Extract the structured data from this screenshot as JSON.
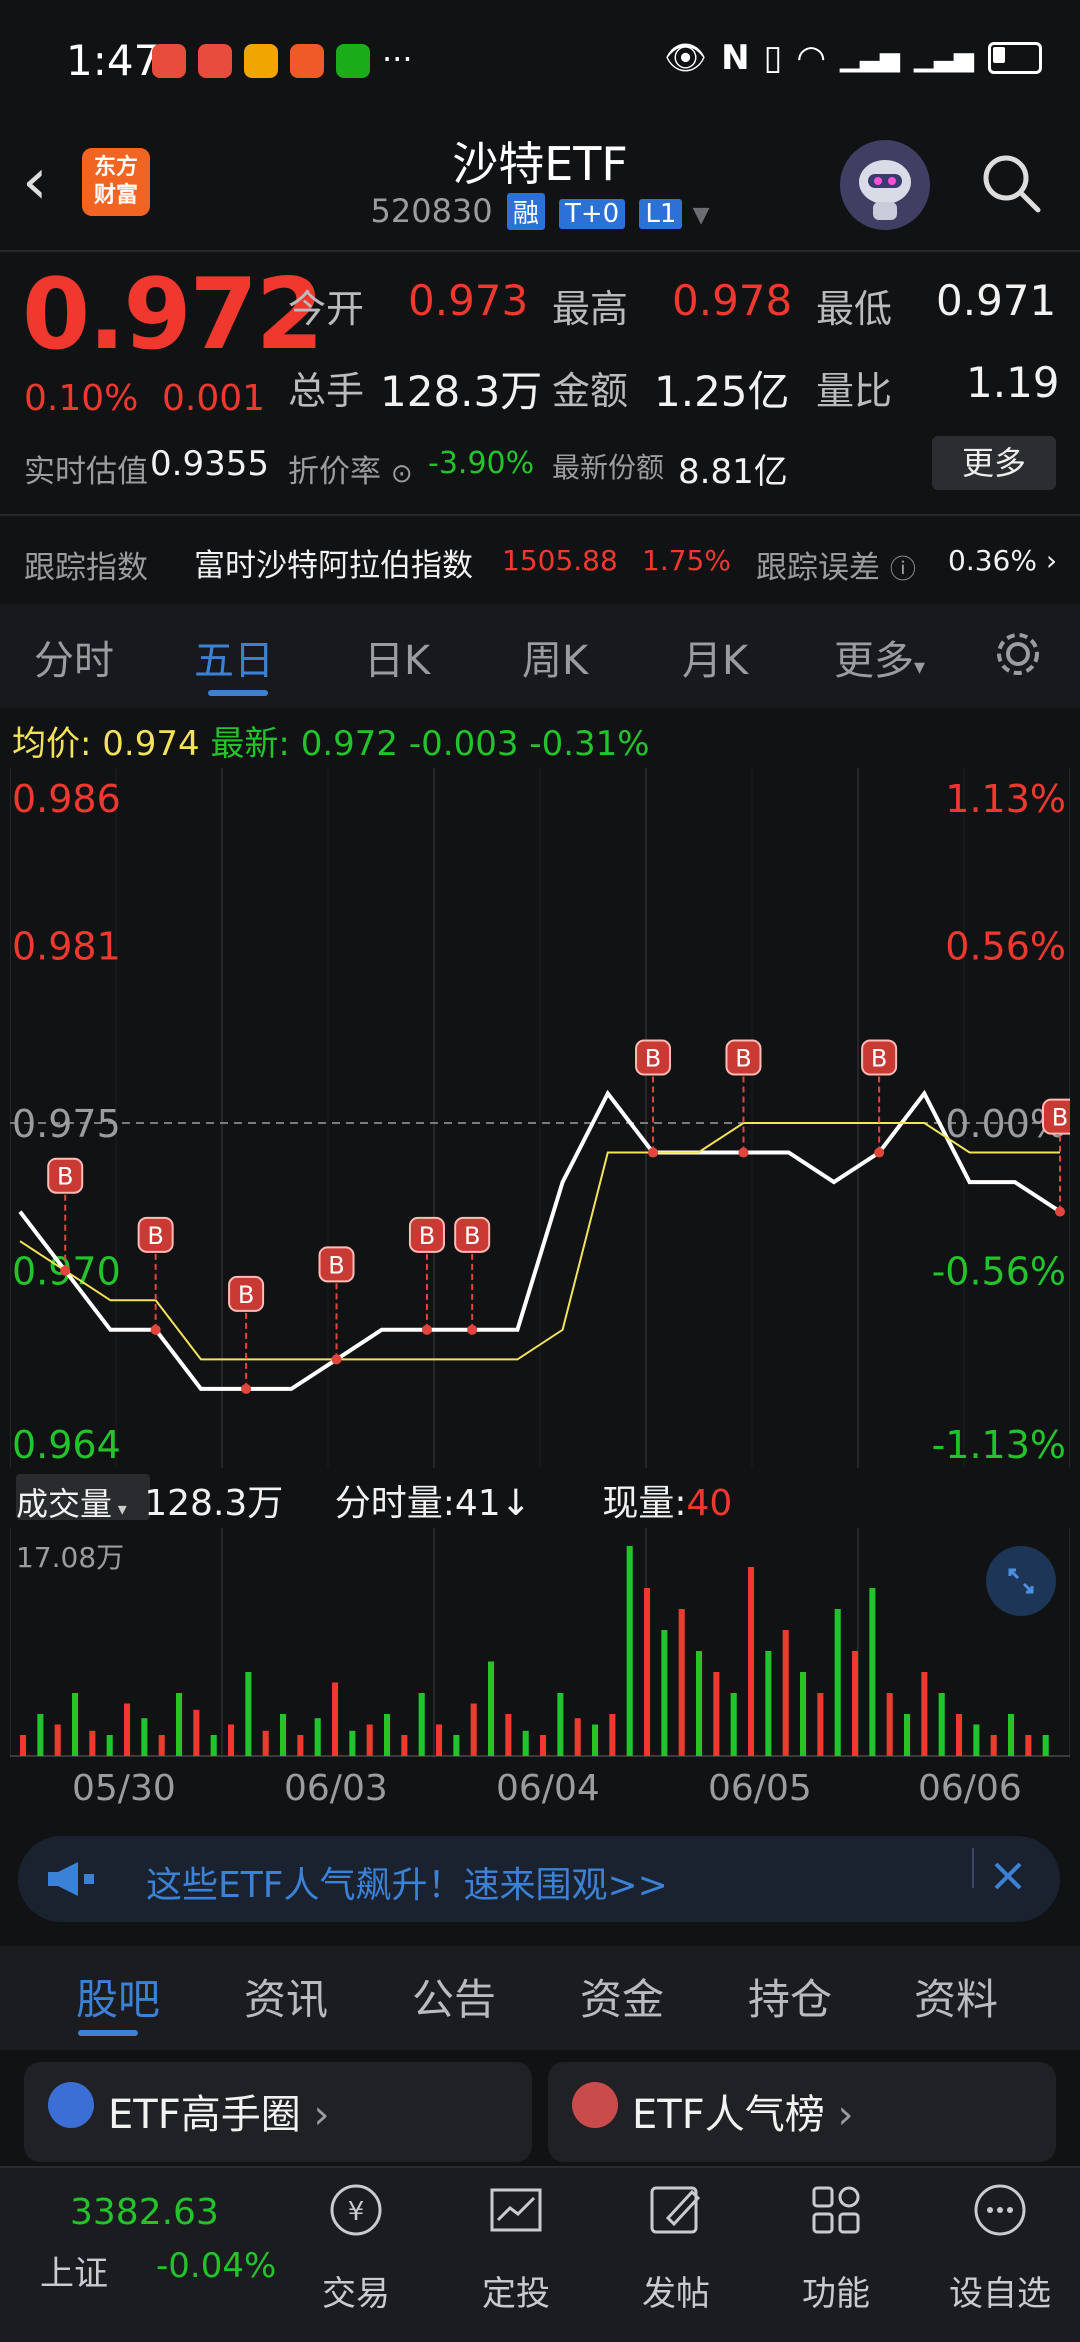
{
  "status_bar": {
    "time": "1:47",
    "more": "···"
  },
  "header": {
    "title": "沙特ETF",
    "code": "520830",
    "badges": [
      "融",
      "T+0",
      "L1"
    ],
    "logo_text": "东方\n财富"
  },
  "quote": {
    "price": "0.972",
    "change_pct": "0.10%",
    "change_abs": "0.001",
    "open_label": "今开",
    "open": "0.973",
    "high_label": "最高",
    "high": "0.978",
    "low_label": "最低",
    "low": "0.971",
    "volume_label": "总手",
    "volume": "128.3万",
    "amount_label": "金额",
    "amount": "1.25亿",
    "ratio_label": "量比",
    "ratio": "1.19",
    "iopv_label": "实时估值",
    "iopv": "0.9355",
    "discount_label": "折价率",
    "discount": "-3.90%",
    "shares_label": "最新份额",
    "shares": "8.81亿",
    "more_label": "更多"
  },
  "tracking": {
    "label": "跟踪指数",
    "index_name": "富时沙特阿拉伯指数",
    "index_value": "1505.88",
    "index_change": "1.75%",
    "error_label": "跟踪误差",
    "error_value": "0.36%"
  },
  "chart_tabs": [
    "分时",
    "五日",
    "日K",
    "周K",
    "月K",
    "更多"
  ],
  "chart_header": {
    "avg_label": "均价:",
    "avg_value": "0.974",
    "latest_label": "最新:",
    "latest_value": "0.972",
    "chg": "-0.003",
    "chg_pct": "-0.31%"
  },
  "chart_data": {
    "type": "line",
    "x": [
      "05/30",
      "06/03",
      "06/04",
      "06/05",
      "06/06"
    ],
    "y_ticks_left": [
      "0.986",
      "0.981",
      "0.975",
      "0.970",
      "0.964"
    ],
    "y_ticks_right": [
      "1.13%",
      "0.56%",
      "0.00%",
      "-0.56%",
      "-1.13%"
    ],
    "ylim": [
      0.964,
      0.986
    ],
    "reference_price": 0.975,
    "series": [
      {
        "values": [
          0.972,
          0.97,
          0.968,
          0.968,
          0.966,
          0.966,
          0.966,
          0.967,
          0.968,
          0.968,
          0.968,
          0.968,
          0.973,
          0.976,
          0.974,
          0.974,
          0.974,
          0.974,
          0.973,
          0.974,
          0.976,
          0.973,
          0.973,
          0.972
        ]
      },
      {
        "values": [
          0.971,
          0.97,
          0.969,
          0.969,
          0.967,
          0.967,
          0.967,
          0.967,
          0.967,
          0.967,
          0.967,
          0.967,
          0.968,
          0.974,
          0.974,
          0.974,
          0.975,
          0.975,
          0.975,
          0.975,
          0.975,
          0.974,
          0.974,
          0.974
        ]
      }
    ],
    "buy_markers": "B"
  },
  "volume": {
    "label": "成交量",
    "total": "128.3万",
    "minute_label": "分时量:41↓",
    "now_label": "现量:",
    "now_value": "40",
    "max_label": "17.08万",
    "values": [
      0.1,
      0.2,
      0.15,
      0.3,
      0.12,
      0.1,
      0.25,
      0.18,
      0.1,
      0.3,
      0.22,
      0.1,
      0.15,
      0.4,
      0.12,
      0.2,
      0.1,
      0.18,
      0.35,
      0.12,
      0.15,
      0.2,
      0.1,
      0.3,
      0.15,
      0.1,
      0.25,
      0.45,
      0.2,
      0.12,
      0.1,
      0.3,
      0.18,
      0.15,
      0.2,
      1.0,
      0.8,
      0.6,
      0.7,
      0.5,
      0.4,
      0.3,
      0.9,
      0.5,
      0.6,
      0.4,
      0.3,
      0.7,
      0.5,
      0.8,
      0.3,
      0.2,
      0.4,
      0.3,
      0.2,
      0.15,
      0.1,
      0.2,
      0.1,
      0.1
    ]
  },
  "banner": {
    "text": "这些ETF人气飙升！速来围观>>"
  },
  "bottom_tabs": [
    "股吧",
    "资讯",
    "公告",
    "资金",
    "持仓",
    "资料"
  ],
  "cards": [
    {
      "title": "ETF高手圈"
    },
    {
      "title": "ETF人气榜"
    }
  ],
  "bottom_nav": {
    "index_value": "3382.63",
    "index_name": "上证",
    "index_change": "-0.04%",
    "items": [
      "交易",
      "定投",
      "发帖",
      "功能",
      "设自选"
    ]
  },
  "colors": {
    "up": "#f0382f",
    "down": "#22c32b",
    "accent": "#3b82d6",
    "avg": "#f3e25b"
  }
}
